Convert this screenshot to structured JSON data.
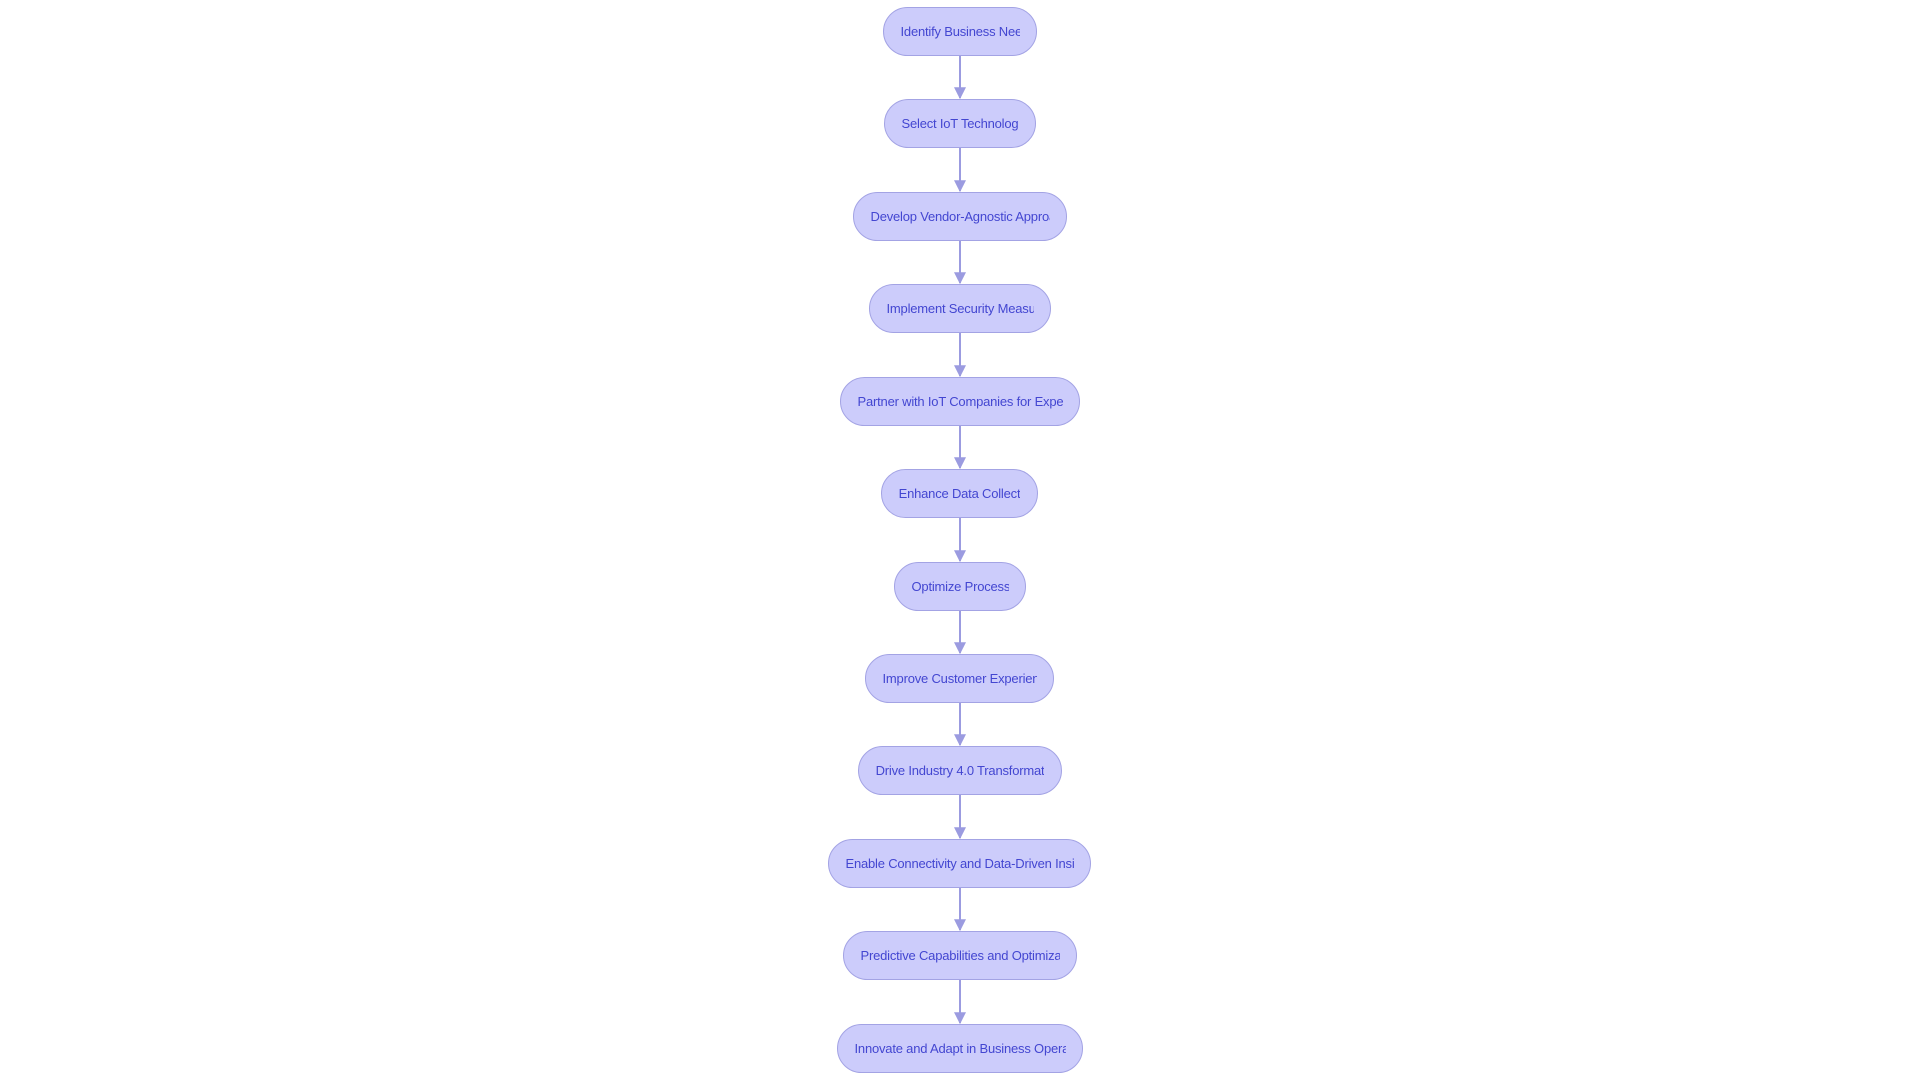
{
  "diagram": {
    "type": "flowchart",
    "direction": "top-to-bottom",
    "colors": {
      "node_fill": "#ccccfb",
      "node_stroke": "#a3a3e4",
      "text": "#4346d1",
      "edge": "#9b9be0"
    },
    "nodes": [
      {
        "id": "n1",
        "label": "Identify Business Nee"
      },
      {
        "id": "n2",
        "label": "Select IoT Technologi"
      },
      {
        "id": "n3",
        "label": "Develop Vendor-Agnostic Approa"
      },
      {
        "id": "n4",
        "label": "Implement Security Measu"
      },
      {
        "id": "n5",
        "label": "Partner with IoT Companies for Exper"
      },
      {
        "id": "n6",
        "label": "Enhance Data Collect"
      },
      {
        "id": "n7",
        "label": "Optimize Process"
      },
      {
        "id": "n8",
        "label": "Improve Customer Experien"
      },
      {
        "id": "n9",
        "label": "Drive Industry 4.0 Transformat"
      },
      {
        "id": "n10",
        "label": "Enable Connectivity and Data-Driven Insi"
      },
      {
        "id": "n11",
        "label": "Predictive Capabilities and Optimiza"
      },
      {
        "id": "n12",
        "label": "Innovate and Adapt in Business Operat"
      }
    ],
    "edges": [
      {
        "from": "n1",
        "to": "n2"
      },
      {
        "from": "n2",
        "to": "n3"
      },
      {
        "from": "n3",
        "to": "n4"
      },
      {
        "from": "n4",
        "to": "n5"
      },
      {
        "from": "n5",
        "to": "n6"
      },
      {
        "from": "n6",
        "to": "n7"
      },
      {
        "from": "n7",
        "to": "n8"
      },
      {
        "from": "n8",
        "to": "n9"
      },
      {
        "from": "n9",
        "to": "n10"
      },
      {
        "from": "n10",
        "to": "n11"
      },
      {
        "from": "n11",
        "to": "n12"
      }
    ]
  }
}
